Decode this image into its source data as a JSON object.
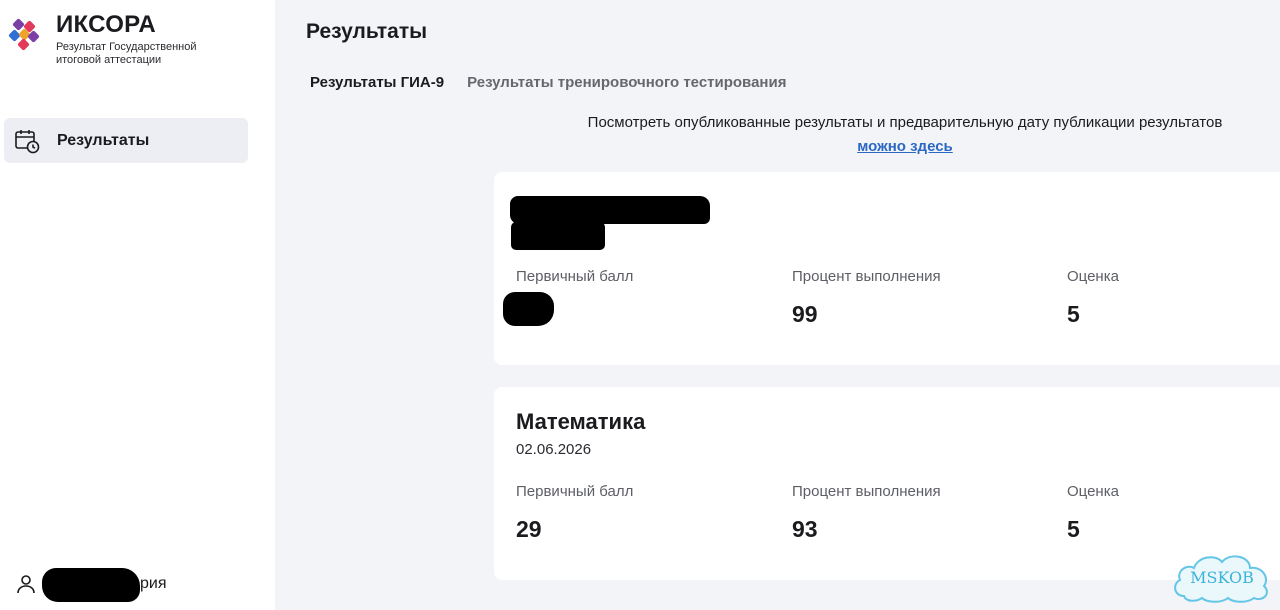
{
  "app": {
    "title": "ИКСОРА",
    "subtitle": "Результат Государственной итоговой аттестации"
  },
  "sidebar": {
    "items": [
      {
        "label": "Результаты",
        "icon": "calendar-clock-icon",
        "active": true
      }
    ],
    "user": {
      "name_suffix": "рия",
      "icon": "user-icon"
    }
  },
  "main": {
    "title": "Результаты",
    "tabs": [
      {
        "label": "Результаты ГИА-9",
        "active": true
      },
      {
        "label": "Результаты тренировочного тестирования",
        "active": false
      }
    ],
    "notice": {
      "text": "Посмотреть опубликованные результаты и предварительную дату публикации результатов",
      "link": "можно здесь"
    },
    "cards": [
      {
        "subject": "",
        "date": "",
        "primary_label": "Первичный балл",
        "primary_value": "",
        "percent_label": "Процент выполнения",
        "percent_value": "99",
        "grade_label": "Оценка",
        "grade_value": "5"
      },
      {
        "subject": "Математика",
        "date": "02.06.2026",
        "primary_label": "Первичный балл",
        "primary_value": "29",
        "percent_label": "Процент выполнения",
        "percent_value": "93",
        "grade_label": "Оценка",
        "grade_value": "5"
      }
    ]
  },
  "watermark": {
    "text": "MSKOB"
  },
  "colors": {
    "accent_link": "#2b68c4",
    "sidebar_active_bg": "#eceef3",
    "page_bg": "#f3f4f8"
  }
}
